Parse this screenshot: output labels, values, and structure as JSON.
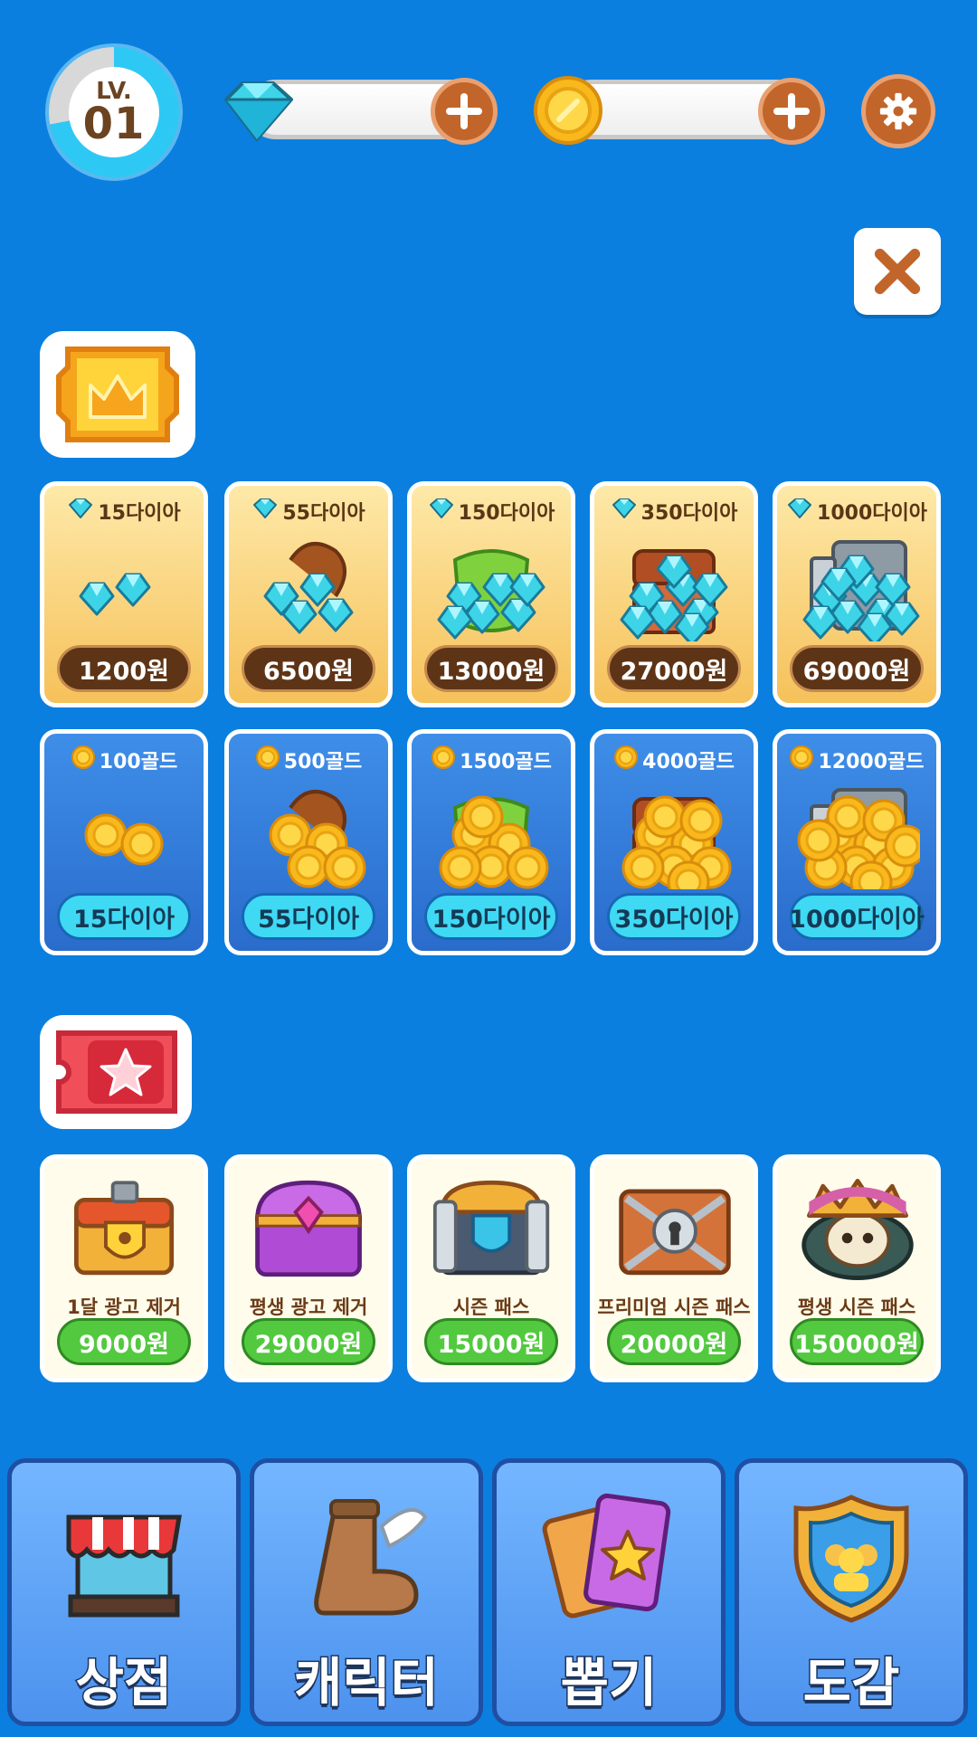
{
  "hud": {
    "level_prefix": "LV.",
    "level_value": "01",
    "level_progress": 0.72,
    "gem_amount": "",
    "gold_amount": ""
  },
  "diamond_packs": [
    {
      "label": "15다이아",
      "price": "1200원"
    },
    {
      "label": "55다이아",
      "price": "6500원"
    },
    {
      "label": "150다이아",
      "price": "13000원"
    },
    {
      "label": "350다이아",
      "price": "27000원"
    },
    {
      "label": "1000다이아",
      "price": "69000원"
    }
  ],
  "gold_packs": [
    {
      "label": "100골드",
      "price": "15다이아"
    },
    {
      "label": "500골드",
      "price": "55다이아"
    },
    {
      "label": "1500골드",
      "price": "150다이아"
    },
    {
      "label": "4000골드",
      "price": "350다이아"
    },
    {
      "label": "12000골드",
      "price": "1000다이아"
    }
  ],
  "special_items": [
    {
      "name": "1달 광고 제거",
      "price": "9000원"
    },
    {
      "name": "평생 광고 제거",
      "price": "29000원"
    },
    {
      "name": "시즌 패스",
      "price": "15000원"
    },
    {
      "name": "프리미엄 시즌 패스",
      "price": "20000원"
    },
    {
      "name": "평생 시즌 패스",
      "price": "150000원"
    }
  ],
  "nav": [
    {
      "label": "상점",
      "icon": "shop-icon"
    },
    {
      "label": "캐릭터",
      "icon": "winged-boot-icon"
    },
    {
      "label": "뽑기",
      "icon": "card-draw-icon"
    },
    {
      "label": "도감",
      "icon": "collection-shield-icon"
    }
  ],
  "colors": {
    "background": "#0a7fe0",
    "diamond_card": "#f6c15a",
    "gold_card": "#2a6ccc",
    "price_brown": "#5e3416",
    "price_cyan": "#3fd9f4",
    "price_green": "#53c93f",
    "button_orange": "#c2652a"
  }
}
